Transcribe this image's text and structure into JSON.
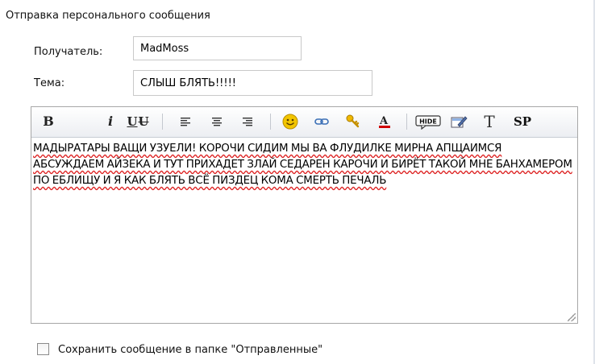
{
  "form": {
    "title": "Отправка персонального сообщения",
    "recipient_label": "Получатель:",
    "recipient_value": "MadMoss",
    "subject_label": "Тема:",
    "subject_value": "СЛЫШ БЛЯТЬ!!!!!"
  },
  "toolbar": {
    "bold": "B",
    "italic": "i",
    "underline": "U",
    "strike": "U",
    "text_style": "T",
    "sp": "SP",
    "hide": "HIDE",
    "icons": [
      "bold-icon",
      "italic-icon",
      "underline-icon",
      "strikethrough-icon",
      "align-left-icon",
      "align-center-icon",
      "align-right-icon",
      "smiley-icon",
      "link-icon",
      "key-icon",
      "font-color-icon",
      "hide-icon",
      "edit-icon",
      "text-style-icon",
      "sp-icon"
    ],
    "colors": {
      "smiley": "#f2c500",
      "link": "#3b6fb6",
      "key": "#e2a800",
      "font_color_bar": "#d10000"
    }
  },
  "editor": {
    "message": "МАДЫРАТАРЫ ВАЩИ УЗУЕЛИ! КОРОЧИ СИДИМ МЫ ВА ФЛУДИЛКЕ МИРНА АПЩАИМСЯ АБСУЖДАЕМ АЙЗЕКА И ТУТ ПРИХАДЕТ ЗЛАЙ СЕДАРЕН КАРОЧИ И БИРЁТ ТАКОЙ МНЕ БАНХАМЕРОМ ПО ЕБЛИЩУ И Я КАК БЛЯТЬ ВСЁ ПИЗДЕЦ КОМА СМЕРТЬ ПЕЧАЛЬ"
  },
  "save_copy": {
    "label": "Сохранить сообщение в папке \"Отправленные\"",
    "checked": false
  }
}
